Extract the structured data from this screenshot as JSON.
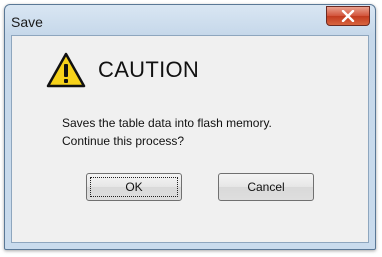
{
  "window": {
    "title": "Save"
  },
  "dialog": {
    "heading": "CAUTION",
    "message_lines": [
      "Saves the table data into flash memory.",
      "Continue this process?"
    ],
    "ok_label": "OK",
    "cancel_label": "Cancel"
  },
  "icons": {
    "warning": "warning-triangle-icon",
    "close": "close-x-icon"
  },
  "colors": {
    "close_button": "#c7432a",
    "warning_yellow": "#f6d21a",
    "titlebar": "#c9dbed"
  }
}
